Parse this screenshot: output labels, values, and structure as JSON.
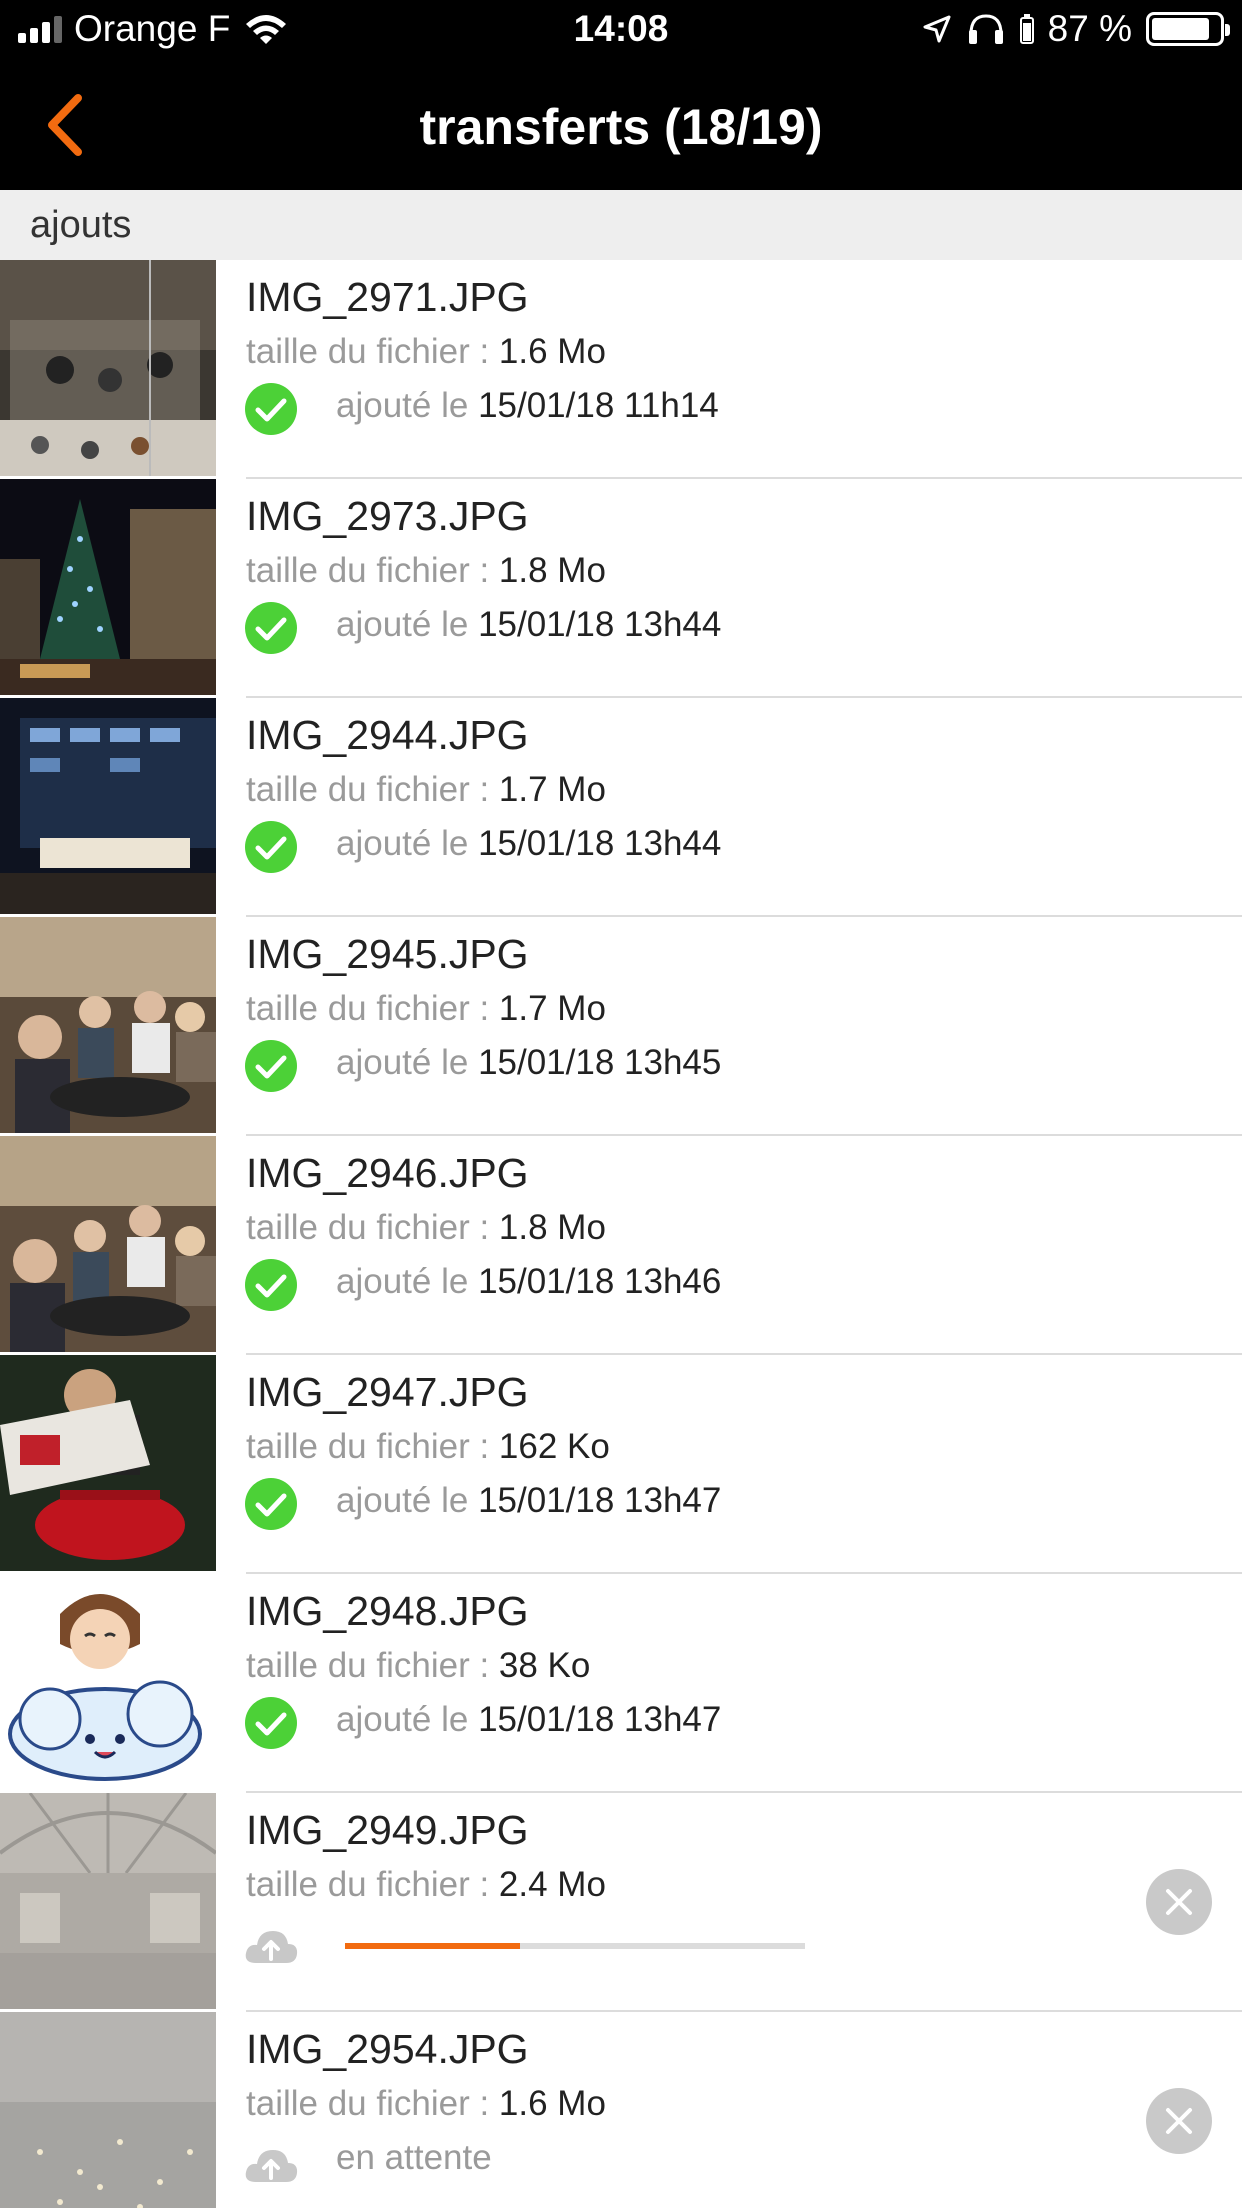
{
  "status": {
    "carrier": "Orange F",
    "time": "14:08",
    "battery": "87 %",
    "battery_level": 0.87
  },
  "nav": {
    "title": "transferts (18/19)"
  },
  "section": {
    "label": "ajouts"
  },
  "labels": {
    "size": "taille du fichier :",
    "added": "ajouté le",
    "pending": "en attente"
  },
  "colors": {
    "accent": "#f26b10",
    "success": "#4cd137",
    "section_bg": "#eeeeee"
  },
  "items": [
    {
      "name": "IMG_2971.JPG",
      "size": "1.6 Mo",
      "date": "15/01/18 11h14",
      "state": "done"
    },
    {
      "name": "IMG_2973.JPG",
      "size": "1.8 Mo",
      "date": "15/01/18 13h44",
      "state": "done"
    },
    {
      "name": "IMG_2944.JPG",
      "size": "1.7 Mo",
      "date": "15/01/18 13h44",
      "state": "done"
    },
    {
      "name": "IMG_2945.JPG",
      "size": "1.7 Mo",
      "date": "15/01/18 13h45",
      "state": "done"
    },
    {
      "name": "IMG_2946.JPG",
      "size": "1.8 Mo",
      "date": "15/01/18 13h46",
      "state": "done"
    },
    {
      "name": "IMG_2947.JPG",
      "size": "162 Ko",
      "date": "15/01/18 13h47",
      "state": "done"
    },
    {
      "name": "IMG_2948.JPG",
      "size": "38 Ko",
      "date": "15/01/18 13h47",
      "state": "done"
    },
    {
      "name": "IMG_2949.JPG",
      "size": "2.4 Mo",
      "state": "uploading",
      "progress": 0.38
    },
    {
      "name": "IMG_2954.JPG",
      "size": "1.6 Mo",
      "state": "pending"
    }
  ],
  "icons": {
    "back": "chevron-left-icon",
    "done": "check-circle-icon",
    "upload": "cloud-upload-icon",
    "cancel": "close-circle-icon"
  }
}
